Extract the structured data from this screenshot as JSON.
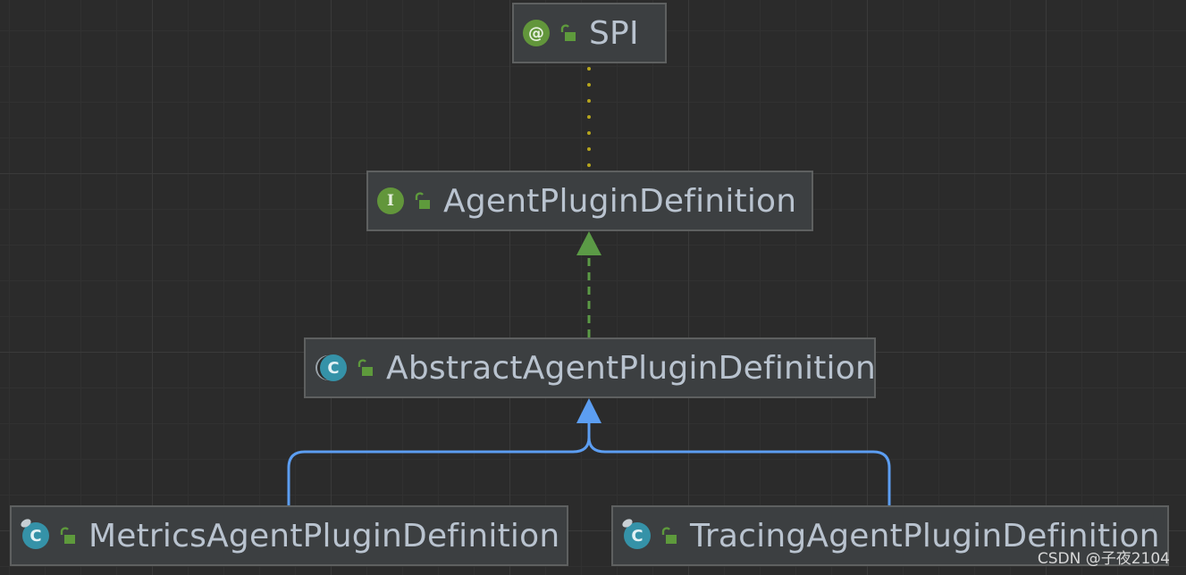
{
  "nodes": {
    "spi": {
      "badge": "@",
      "label": "SPI",
      "kind": "annotation"
    },
    "agent_plugin_definition": {
      "badge": "I",
      "label": "AgentPluginDefinition",
      "kind": "interface"
    },
    "abstract_agent_plugin_definition": {
      "badge": "C",
      "label": "AbstractAgentPluginDefinition",
      "kind": "abstract-class"
    },
    "metrics_agent_plugin_definition": {
      "badge": "C",
      "label": "MetricsAgentPluginDefinition",
      "kind": "final-class"
    },
    "tracing_agent_plugin_definition": {
      "badge": "C",
      "label": "TracingAgentPluginDefinition",
      "kind": "final-class"
    }
  },
  "edges": [
    {
      "from": "agent_plugin_definition",
      "to": "spi",
      "type": "annotated-by",
      "style": "dotted",
      "color": "#b6a51d"
    },
    {
      "from": "abstract_agent_plugin_definition",
      "to": "agent_plugin_definition",
      "type": "implements",
      "style": "dashed",
      "color": "#5b9a46"
    },
    {
      "from": "metrics_agent_plugin_definition",
      "to": "abstract_agent_plugin_definition",
      "type": "extends",
      "style": "solid",
      "color": "#5c9ef2"
    },
    {
      "from": "tracing_agent_plugin_definition",
      "to": "abstract_agent_plugin_definition",
      "type": "extends",
      "style": "solid",
      "color": "#5c9ef2"
    }
  ],
  "colors": {
    "background": "#2b2b2b",
    "node_fill": "#3c3f41",
    "node_border": "#5e6060",
    "text": "#b9c3cf",
    "annotation_interface_badge": "#62963b",
    "class_badge": "#3592a8",
    "lock": "#5e9a3c"
  },
  "icons": {
    "annotation": "at-sign-icon",
    "interface": "interface-icon",
    "class": "class-icon",
    "visibility": "unlocked-padlock-icon"
  },
  "watermark": "CSDN @子夜2104"
}
